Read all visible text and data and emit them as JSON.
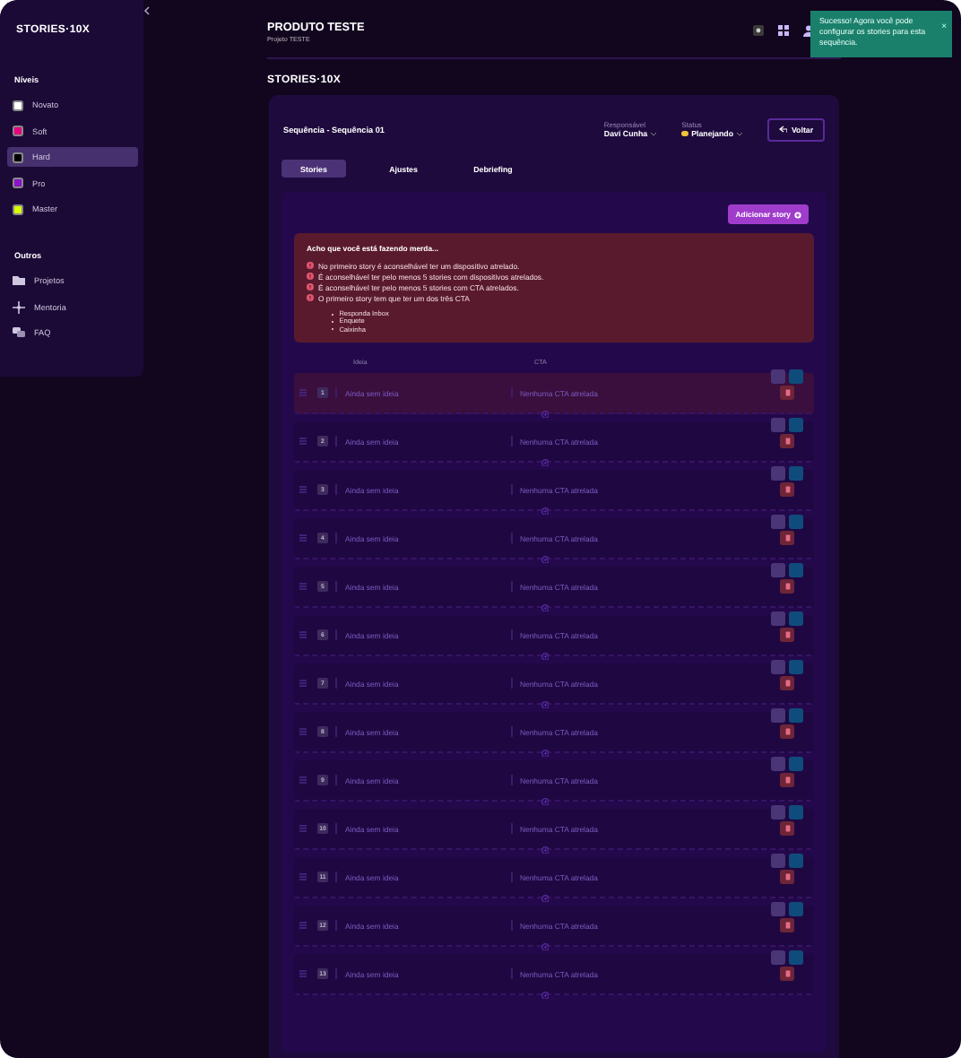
{
  "sidebar": {
    "logo": "STORIES·10X",
    "levels_title": "Níveis",
    "levels": [
      {
        "label": "Novato",
        "color": "#ffffff",
        "selected": false
      },
      {
        "label": "Soft",
        "color": "#e6007e",
        "selected": false
      },
      {
        "label": "Hard",
        "color": "#000000",
        "selected": true
      },
      {
        "label": "Pro",
        "color": "#8a12c9",
        "selected": false
      },
      {
        "label": "Master",
        "color": "#dcff00",
        "selected": false
      }
    ],
    "others_title": "Outros",
    "others": [
      {
        "label": "Projetos",
        "kind": "folder"
      },
      {
        "label": "Mentoria",
        "kind": "mentor"
      },
      {
        "label": "FAQ",
        "kind": "faq"
      }
    ]
  },
  "header": {
    "title": "PRODUTO TESTE",
    "subtitle": "Projeto TESTE"
  },
  "toast": {
    "message": "Sucesso! Agora você pode configurar os stories para esta sequência.",
    "close": "×"
  },
  "logo": "STORIES·10X",
  "sequence": {
    "title": "Sequência - Sequência 01",
    "responsible_label": "Responsável",
    "responsible": "Davi Cunha",
    "status_label": "Status",
    "status": "Planejando",
    "back_button": "Voltar"
  },
  "tabs": [
    {
      "label": "Stories",
      "selected": true
    },
    {
      "label": "Ajustes",
      "selected": false
    },
    {
      "label": "Debriefing",
      "selected": false
    }
  ],
  "add_button": "Adicionar story",
  "warning": {
    "title": "Acho que você está fazendo merda...",
    "items": [
      "No primeiro story é aconselhável ter um dispositivo atrelado.",
      "É aconselhável ter pelo menos 5 stories com dispositivos atrelados.",
      "É aconselhável ter pelo menos 5 stories com CTA atrelados.",
      "O primeiro story tem que ter um dos três CTA"
    ],
    "sub_items": [
      "Responda Inbox",
      "Enquete",
      "Caixinha"
    ]
  },
  "columns": [
    "Ideia",
    "CTA"
  ],
  "rows": [
    {
      "number": "1",
      "idea": "Ainda sem ideia",
      "cta": "Nenhuma CTA atrelada",
      "flagged": true
    },
    {
      "number": "2",
      "idea": "Ainda sem ideia",
      "cta": "Nenhuma CTA atrelada",
      "flagged": false
    },
    {
      "number": "3",
      "idea": "Ainda sem ideia",
      "cta": "Nenhuma CTA atrelada",
      "flagged": false
    },
    {
      "number": "4",
      "idea": "Ainda sem ideia",
      "cta": "Nenhuma CTA atrelada",
      "flagged": false
    },
    {
      "number": "5",
      "idea": "Ainda sem ideia",
      "cta": "Nenhuma CTA atrelada",
      "flagged": false
    },
    {
      "number": "6",
      "idea": "Ainda sem ideia",
      "cta": "Nenhuma CTA atrelada",
      "flagged": false
    },
    {
      "number": "7",
      "idea": "Ainda sem ideia",
      "cta": "Nenhuma CTA atrelada",
      "flagged": false
    },
    {
      "number": "8",
      "idea": "Ainda sem ideia",
      "cta": "Nenhuma CTA atrelada",
      "flagged": false
    },
    {
      "number": "9",
      "idea": "Ainda sem ideia",
      "cta": "Nenhuma CTA atrelada",
      "flagged": false
    },
    {
      "number": "10",
      "idea": "Ainda sem ideia",
      "cta": "Nenhuma CTA atrelada",
      "flagged": false
    },
    {
      "number": "11",
      "idea": "Ainda sem ideia",
      "cta": "Nenhuma CTA atrelada",
      "flagged": false
    },
    {
      "number": "12",
      "idea": "Ainda sem ideia",
      "cta": "Nenhuma CTA atrelada",
      "flagged": false
    },
    {
      "number": "13",
      "idea": "Ainda sem ideia",
      "cta": "Nenhuma CTA atrelada",
      "flagged": false
    }
  ]
}
